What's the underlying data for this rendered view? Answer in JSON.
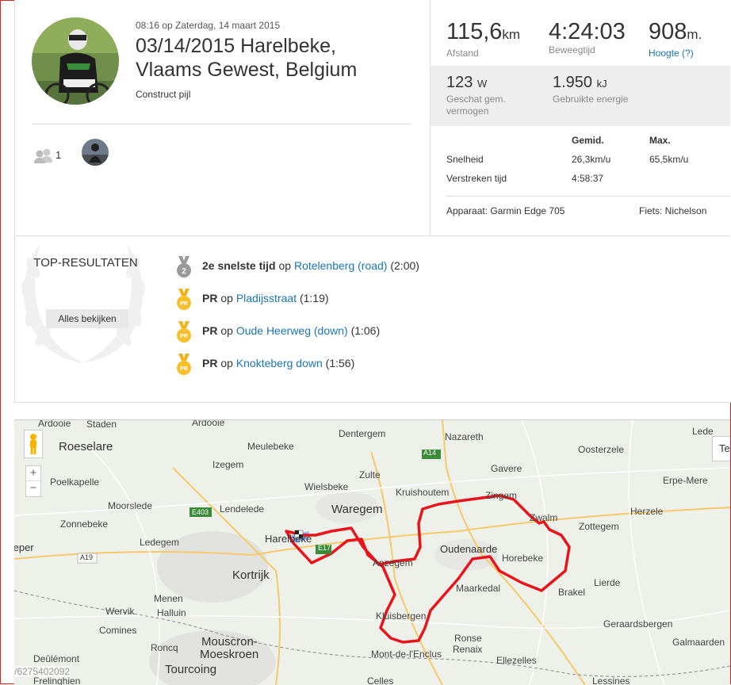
{
  "activity": {
    "datetime": "08:16 op Zaterdag, 14 maart 2015",
    "title": "03/14/2015 Harelbeke, Vlaams Gewest, Belgium",
    "subtitle": "Construct pijl",
    "kudos_count": "1"
  },
  "stats": {
    "distance": {
      "value": "115,6",
      "unit": "km",
      "label": "Afstand"
    },
    "moving_time": {
      "value": "4:24:03",
      "label": "Beweegtijd"
    },
    "elevation": {
      "value": "908",
      "unit": "m.",
      "label": "Hoogte (?)"
    },
    "power": {
      "value": "123",
      "unit": "W",
      "label": "Geschat gem. vermogen"
    },
    "energy": {
      "value": "1.950",
      "unit": "kJ",
      "label": "Gebruikte energie"
    }
  },
  "detail_table": {
    "headers": [
      "Gemid.",
      "Max."
    ],
    "rows": [
      {
        "label": "Snelheid",
        "avg": "26,3km/u",
        "max": "65,5km/u"
      },
      {
        "label": "Verstreken tijd",
        "avg": "4:58:37",
        "max": ""
      }
    ],
    "device": "Apparaat: Garmin Edge 705",
    "bike": "Fiets: Nichelson"
  },
  "top_results": {
    "title": "TOP-RESULTATEN",
    "see_all": "Alles bekijken",
    "items": [
      {
        "medal": "2",
        "achievement": "2e snelste tijd",
        "op": "op",
        "segment": "Rotelenberg (road)",
        "time": "(2:00)"
      },
      {
        "medal": "PR",
        "achievement": "PR",
        "op": "op",
        "segment": "Pladijsstraat",
        "time": "(1:19)"
      },
      {
        "medal": "PR",
        "achievement": "PR",
        "op": "op",
        "segment": "Oude Heerweg (down)",
        "time": "(1:06)"
      },
      {
        "medal": "PR",
        "achievement": "PR",
        "op": "op",
        "segment": "Knokteberg down",
        "time": "(1:56)"
      }
    ]
  },
  "map": {
    "route_color": "#e8141b",
    "type_button": "Te",
    "watermark": "/6275402092",
    "labels": {
      "staden": "Staden",
      "ardooie": "Ardooie",
      "dentergem": "Dentergem",
      "nazareth": "Nazareth",
      "lede": "Lede",
      "roeselare": "Roeselare",
      "meulebeke": "Meulebeke",
      "a14": "A14",
      "oosterzele": "Oosterzele",
      "izegem": "Izegem",
      "zulte": "Zulte",
      "gavere": "Gavere",
      "poelkapelle": "Poelkapelle",
      "wielsbeke": "Wielsbeke",
      "kruishoutem": "Kruishoutem",
      "zingem": "Zingem",
      "erpemere": "Erpe-Mere",
      "moorslede": "Moorslede",
      "lendelede": "Lendelede",
      "waregem": "Waregem",
      "zonnebeke": "Zonnebeke",
      "e403": "E403",
      "zwalm": "Zwalm",
      "herzele": "Herzele",
      "harelbeke": "Harelbeke",
      "zottegem": "Zottegem",
      "ledegem": "Ledegem",
      "ieper": "Ieper",
      "e17": "E17",
      "oudenaarde": "Oudenaarde",
      "anzegem": "Anzegem",
      "horebeke": "Horebeke",
      "a19": "A19",
      "kortrijk": "Kortrijk",
      "lierde": "Lierde",
      "maarkedal": "Maarkedal",
      "brakel": "Brakel",
      "menen": "Menen",
      "wervik": "Wervik",
      "halluin": "Halluin",
      "kluisbergen": "Kluisbergen",
      "geraardsbergen": "Geraardsbergen",
      "comines": "Comines",
      "mouscron": "Mouscron-",
      "moeskroen": "Moeskroen",
      "ronse": "Ronse",
      "renaix": "Renaix",
      "galmaarden": "Galmaarden",
      "roncq": "Roncq",
      "deulemont": "Deûlémont",
      "tourcoing": "Tourcoing",
      "mont": "Mont-de-l'Enclus",
      "ellezelles": "Ellezelles",
      "frelinghien": "Frelinghien",
      "celles": "Celles",
      "lessines": "Lessines"
    }
  }
}
